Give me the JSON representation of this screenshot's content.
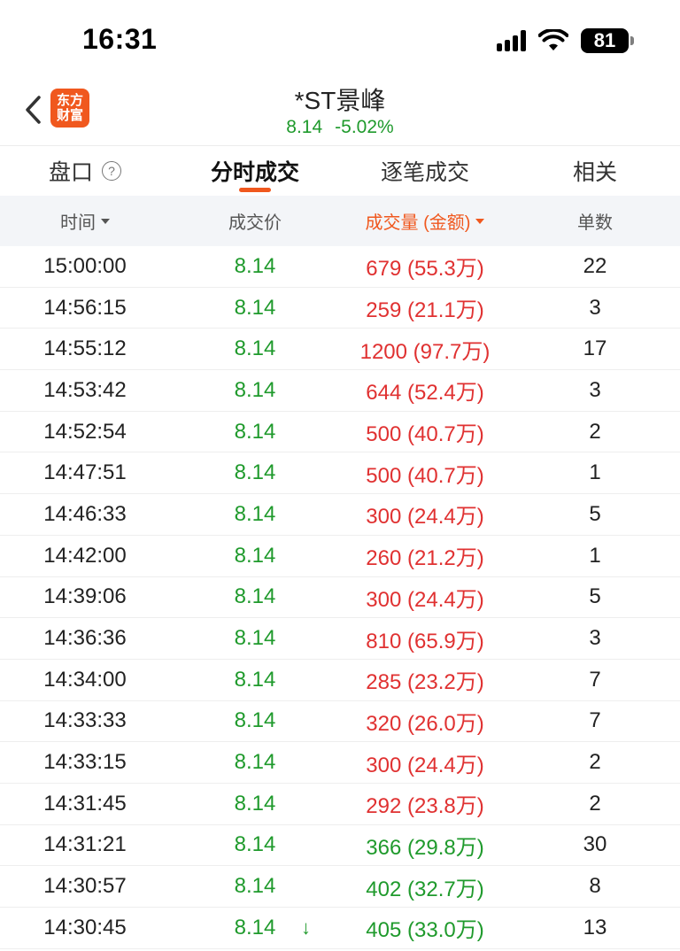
{
  "status_bar": {
    "time": "16:31",
    "battery": "81"
  },
  "nav": {
    "logo_line1": "东方",
    "logo_line2": "财富",
    "title": "*ST景峰",
    "price": "8.14",
    "change_pct": "-5.02%"
  },
  "tabs": [
    {
      "label": "盘口",
      "active": false
    },
    {
      "label": "分时成交",
      "active": true
    },
    {
      "label": "逐笔成交",
      "active": false
    },
    {
      "label": "相关",
      "active": false
    }
  ],
  "help_icon": "?",
  "columns": {
    "time": "时间",
    "price": "成交价",
    "volume": "成交量 (金额)",
    "count": "单数"
  },
  "colors": {
    "up": "#e03131",
    "down": "#1f9a2c",
    "accent": "#f0581e"
  },
  "rows": [
    {
      "time": "15:00:00",
      "price": "8.14",
      "volume": "679 (55.3万)",
      "count": "22",
      "dir": "red"
    },
    {
      "time": "14:56:15",
      "price": "8.14",
      "volume": "259 (21.1万)",
      "count": "3",
      "dir": "red"
    },
    {
      "time": "14:55:12",
      "price": "8.14",
      "volume": "1200 (97.7万)",
      "count": "17",
      "dir": "red"
    },
    {
      "time": "14:53:42",
      "price": "8.14",
      "volume": "644 (52.4万)",
      "count": "3",
      "dir": "red"
    },
    {
      "time": "14:52:54",
      "price": "8.14",
      "volume": "500 (40.7万)",
      "count": "2",
      "dir": "red"
    },
    {
      "time": "14:47:51",
      "price": "8.14",
      "volume": "500 (40.7万)",
      "count": "1",
      "dir": "red"
    },
    {
      "time": "14:46:33",
      "price": "8.14",
      "volume": "300 (24.4万)",
      "count": "5",
      "dir": "red"
    },
    {
      "time": "14:42:00",
      "price": "8.14",
      "volume": "260 (21.2万)",
      "count": "1",
      "dir": "red"
    },
    {
      "time": "14:39:06",
      "price": "8.14",
      "volume": "300 (24.4万)",
      "count": "5",
      "dir": "red"
    },
    {
      "time": "14:36:36",
      "price": "8.14",
      "volume": "810 (65.9万)",
      "count": "3",
      "dir": "red"
    },
    {
      "time": "14:34:00",
      "price": "8.14",
      "volume": "285 (23.2万)",
      "count": "7",
      "dir": "red"
    },
    {
      "time": "14:33:33",
      "price": "8.14",
      "volume": "320 (26.0万)",
      "count": "7",
      "dir": "red"
    },
    {
      "time": "14:33:15",
      "price": "8.14",
      "volume": "300 (24.4万)",
      "count": "2",
      "dir": "red"
    },
    {
      "time": "14:31:45",
      "price": "8.14",
      "volume": "292 (23.8万)",
      "count": "2",
      "dir": "red"
    },
    {
      "time": "14:31:21",
      "price": "8.14",
      "volume": "366 (29.8万)",
      "count": "30",
      "dir": "green"
    },
    {
      "time": "14:30:57",
      "price": "8.14",
      "volume": "402 (32.7万)",
      "count": "8",
      "dir": "green"
    },
    {
      "time": "14:30:45",
      "price": "8.14",
      "volume": "405 (33.0万)",
      "count": "13",
      "dir": "green",
      "arrow": "↓"
    }
  ]
}
